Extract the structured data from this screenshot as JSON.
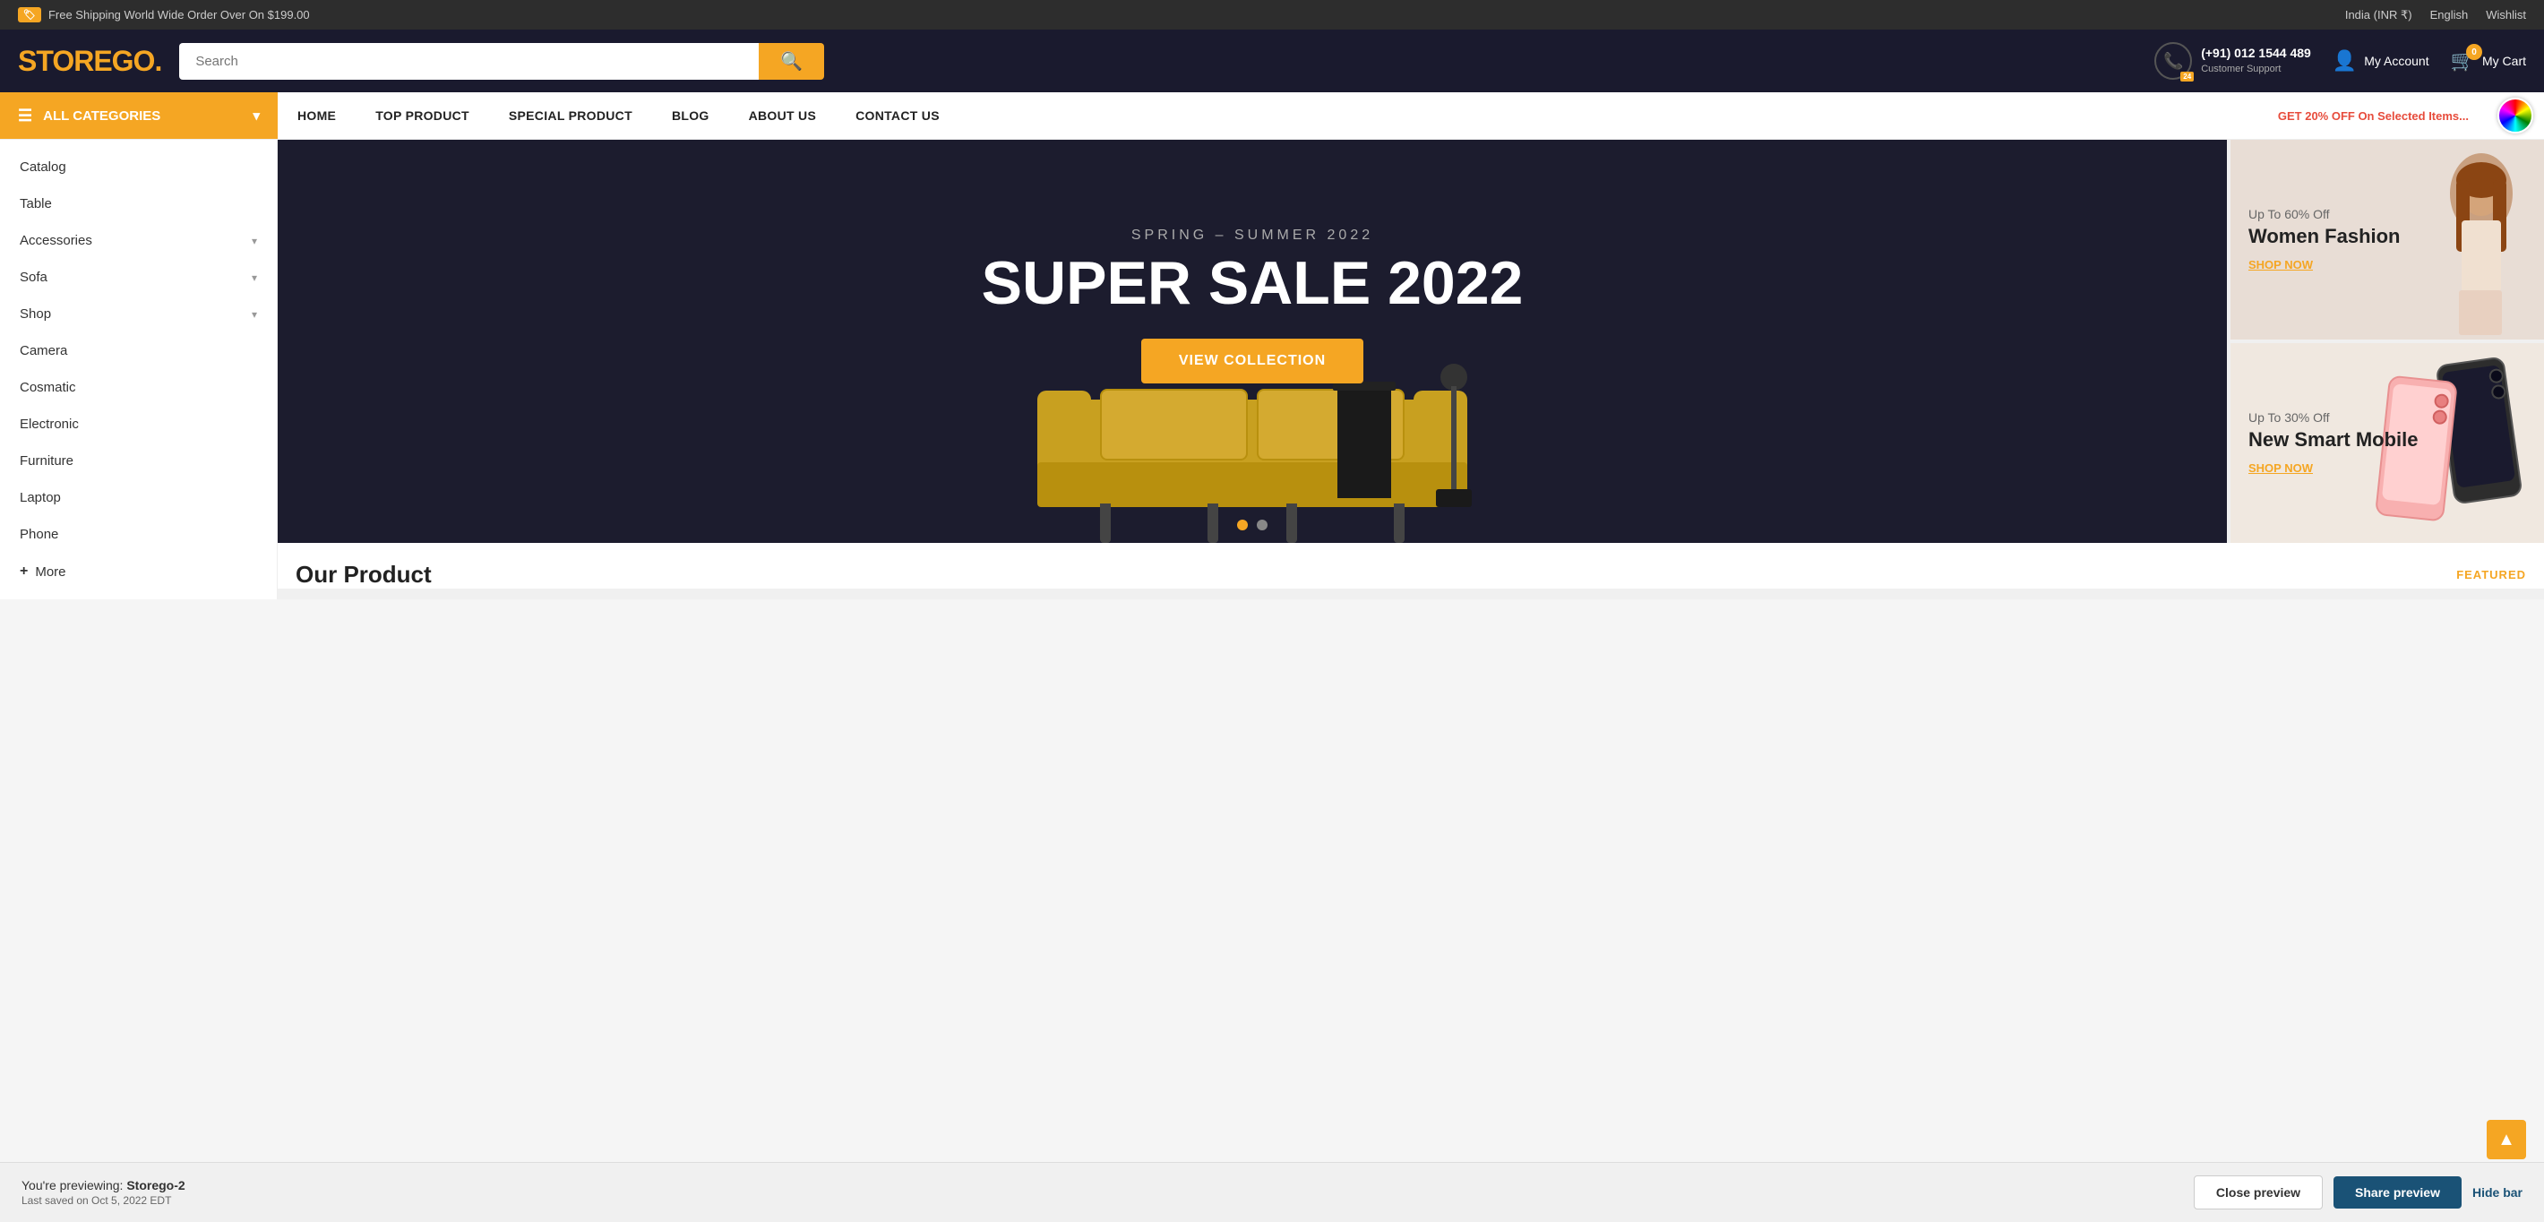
{
  "topbar": {
    "shipping_text": "Free Shipping World Wide Order Over On $199.00",
    "region": "India (INR ₹)",
    "language": "English",
    "wishlist": "Wishlist"
  },
  "header": {
    "logo_text_1": "STORE",
    "logo_text_2": "GO.",
    "search_placeholder": "Search",
    "phone": "(+91) 012 1544 489",
    "support_label": "Customer Support",
    "my_account": "My Account",
    "my_cart": "My Cart",
    "cart_count": "0"
  },
  "nav": {
    "all_categories": "ALL CATEGORIES",
    "items": [
      {
        "label": "HOME"
      },
      {
        "label": "TOP PRODUCT"
      },
      {
        "label": "SPECIAL PRODUCT"
      },
      {
        "label": "BLOG"
      },
      {
        "label": "ABOUT US"
      },
      {
        "label": "CONTACT US"
      }
    ],
    "promo": "GET 20% OFF On Selected Items..."
  },
  "sidebar": {
    "items": [
      {
        "label": "Catalog",
        "has_arrow": false
      },
      {
        "label": "Table",
        "has_arrow": false
      },
      {
        "label": "Accessories",
        "has_arrow": true
      },
      {
        "label": "Sofa",
        "has_arrow": true
      },
      {
        "label": "Shop",
        "has_arrow": true
      },
      {
        "label": "Camera",
        "has_arrow": false
      },
      {
        "label": "Cosmatic",
        "has_arrow": false
      },
      {
        "label": "Electronic",
        "has_arrow": false
      },
      {
        "label": "Furniture",
        "has_arrow": false
      },
      {
        "label": "Laptop",
        "has_arrow": false
      },
      {
        "label": "Phone",
        "has_arrow": false
      }
    ],
    "more_label": "More"
  },
  "hero": {
    "subtitle": "SPRING – SUMMER 2022",
    "title": "SUPER SALE 2022",
    "cta_label": "View Collection"
  },
  "banners": {
    "banner1": {
      "tag": "Up To 60% Off",
      "title": "Women Fashion",
      "cta": "SHOP NOW"
    },
    "banner2": {
      "tag": "Up To 30% Off",
      "title": "New Smart Mobile",
      "cta": "SHOP NOW"
    }
  },
  "products_section": {
    "title": "Our Product",
    "tab": "FEATURED"
  },
  "preview_bar": {
    "previewing_label": "You're previewing:",
    "store_name": "Storego-2",
    "saved_text": "Last saved on Oct 5, 2022 EDT",
    "close_label": "Close preview",
    "share_label": "Share preview",
    "hide_label": "Hide bar"
  }
}
